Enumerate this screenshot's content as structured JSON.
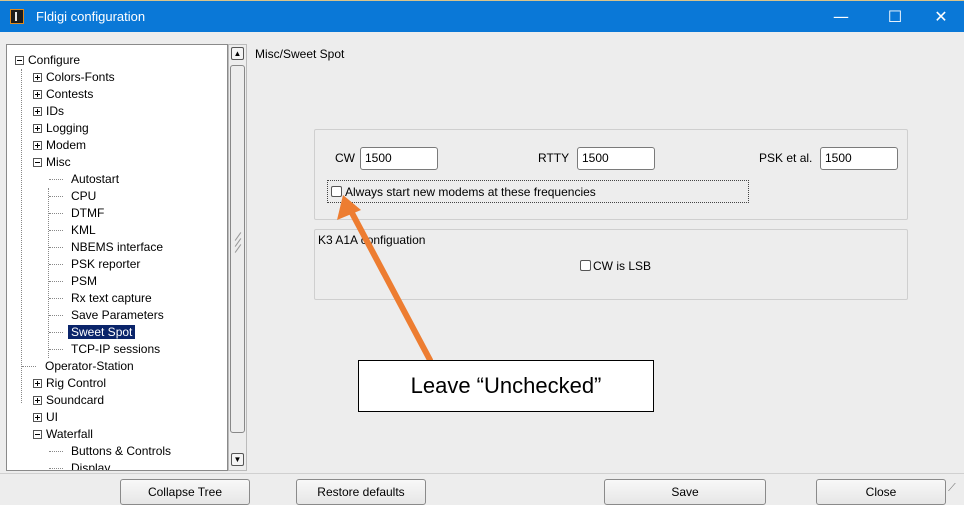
{
  "window": {
    "title": "Fldigi configuration",
    "controls": {
      "minimize": "—",
      "maximize": "☐",
      "close": "✕"
    }
  },
  "tree": {
    "items": [
      {
        "label": "Configure",
        "expander": "minus",
        "level": 0
      },
      {
        "label": "Colors-Fonts",
        "expander": "plus",
        "level": 1
      },
      {
        "label": "Contests",
        "expander": "plus",
        "level": 1
      },
      {
        "label": "IDs",
        "expander": "plus",
        "level": 1
      },
      {
        "label": "Logging",
        "expander": "plus",
        "level": 1
      },
      {
        "label": "Modem",
        "expander": "plus",
        "level": 1
      },
      {
        "label": "Misc",
        "expander": "minus",
        "level": 1
      },
      {
        "label": "Autostart",
        "level": 2
      },
      {
        "label": "CPU",
        "level": 2
      },
      {
        "label": "DTMF",
        "level": 2
      },
      {
        "label": "KML",
        "level": 2
      },
      {
        "label": "NBEMS interface",
        "level": 2
      },
      {
        "label": "PSK reporter",
        "level": 2
      },
      {
        "label": "PSM",
        "level": 2
      },
      {
        "label": "Rx text capture",
        "level": 2
      },
      {
        "label": "Save Parameters",
        "level": 2
      },
      {
        "label": "Sweet Spot",
        "level": 2,
        "selected": true
      },
      {
        "label": "TCP-IP sessions",
        "level": 2
      },
      {
        "label": "Operator-Station",
        "level": 1
      },
      {
        "label": "Rig Control",
        "expander": "plus",
        "level": 1
      },
      {
        "label": "Soundcard",
        "expander": "plus",
        "level": 1
      },
      {
        "label": "UI",
        "expander": "plus",
        "level": 1
      },
      {
        "label": "Waterfall",
        "expander": "minus",
        "level": 1
      },
      {
        "label": "Buttons & Controls",
        "level": 2
      },
      {
        "label": "Display",
        "level": 2
      }
    ]
  },
  "panel": {
    "heading": "Misc/Sweet Spot",
    "cw_label": "CW",
    "cw_value": "1500",
    "rtty_label": "RTTY",
    "rtty_value": "1500",
    "psk_label": "PSK et al.",
    "psk_value": "1500",
    "always_start_label": "Always start new modems at these frequencies",
    "always_start_checked": false,
    "k3_heading": "K3 A1A configuation",
    "cw_lsb_label": "CW is LSB",
    "cw_lsb_checked": false
  },
  "buttons": {
    "collapse": "Collapse Tree",
    "restore": "Restore defaults",
    "save": "Save",
    "close": "Close"
  },
  "annotation": {
    "text": "Leave “Unchecked”",
    "arrow_color": "#ed7d31"
  }
}
